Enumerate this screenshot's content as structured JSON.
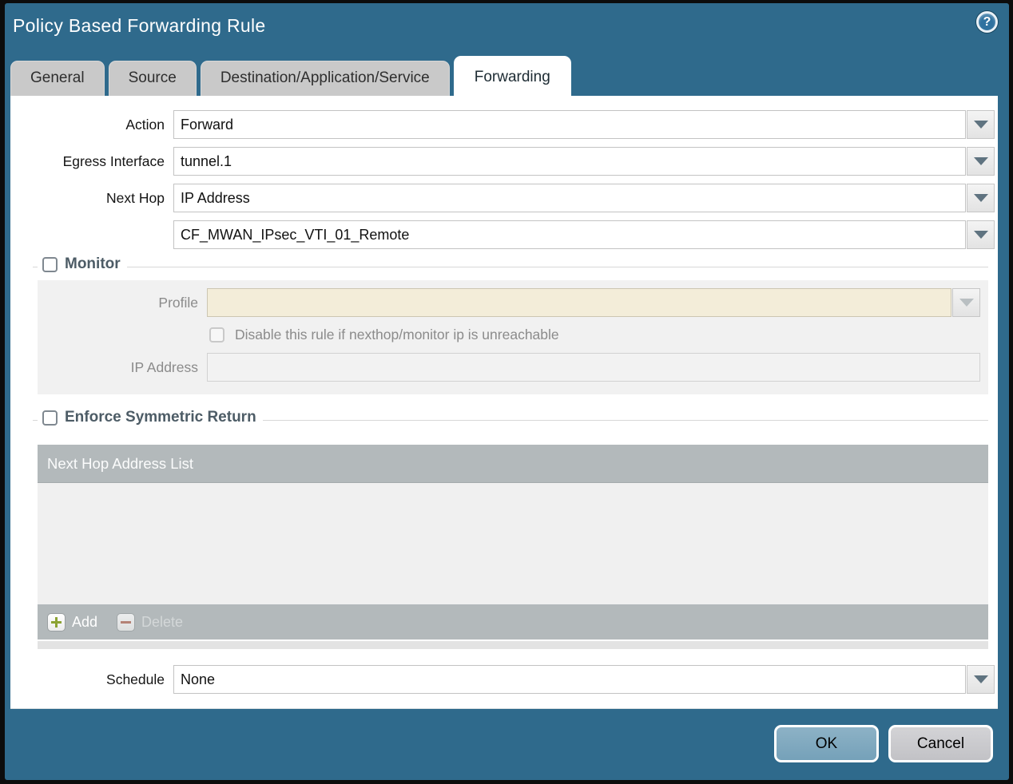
{
  "dialog": {
    "title": "Policy Based Forwarding Rule",
    "help_glyph": "?"
  },
  "tabs": [
    {
      "label": "General",
      "active": false
    },
    {
      "label": "Source",
      "active": false
    },
    {
      "label": "Destination/Application/Service",
      "active": false
    },
    {
      "label": "Forwarding",
      "active": true
    }
  ],
  "form": {
    "action": {
      "label": "Action",
      "value": "Forward"
    },
    "egress_interface": {
      "label": "Egress Interface",
      "value": "tunnel.1"
    },
    "next_hop": {
      "label": "Next Hop",
      "value": "IP Address"
    },
    "next_hop_address": {
      "value": "CF_MWAN_IPsec_VTI_01_Remote"
    },
    "schedule": {
      "label": "Schedule",
      "value": "None"
    }
  },
  "monitor": {
    "legend": "Monitor",
    "checked": false,
    "profile": {
      "label": "Profile",
      "value": ""
    },
    "disable_rule_label": "Disable this rule if nexthop/monitor ip is unreachable",
    "disable_rule_checked": false,
    "ip_address": {
      "label": "IP Address",
      "value": ""
    }
  },
  "symmetric_return": {
    "legend": "Enforce Symmetric Return",
    "checked": false,
    "table_header": "Next Hop Address List",
    "rows": [],
    "add_label": "Add",
    "delete_label": "Delete",
    "delete_enabled": false
  },
  "footer": {
    "ok_label": "OK",
    "cancel_label": "Cancel"
  },
  "colors": {
    "dialog_teal": "#2f6a8c",
    "tab_inactive": "#c9c9c9",
    "fieldset_interior": "#f1f1f1",
    "disabled_field_beige": "#f3edd9",
    "table_gray": "#b3b9bb",
    "add_plus_green": "#8ca334",
    "delete_minus_red": "#b5705f",
    "ok_button": "#7fa9c0",
    "cancel_button": "#c9c9cd"
  }
}
